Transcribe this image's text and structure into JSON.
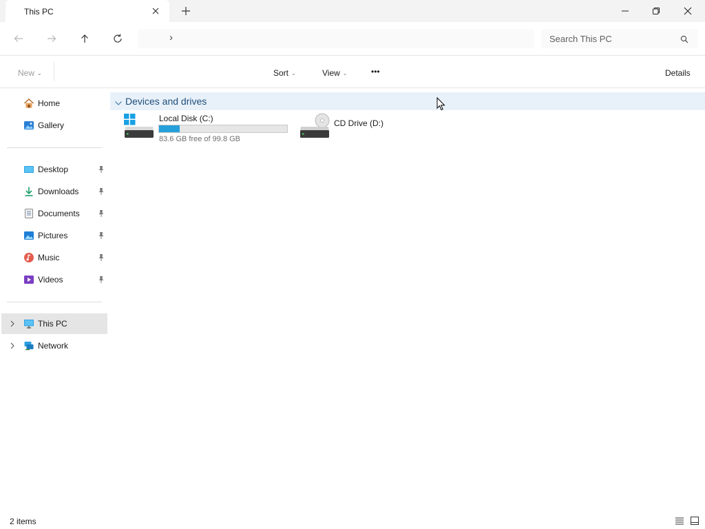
{
  "window": {
    "tab_title": "This PC",
    "controls": [
      "minimize-icon",
      "restore-icon",
      "close-icon"
    ]
  },
  "navigation": {
    "address_separator": "›",
    "search_placeholder": "Search This PC"
  },
  "commandbar": {
    "new_label": "New",
    "sort_label": "Sort",
    "view_label": "View",
    "more_label": "•••",
    "details_label": "Details"
  },
  "sidebar": {
    "quick": [
      {
        "label": "Home",
        "icon": "home-icon"
      },
      {
        "label": "Gallery",
        "icon": "gallery-icon"
      }
    ],
    "pinned": [
      {
        "label": "Desktop",
        "icon": "desktop-icon"
      },
      {
        "label": "Downloads",
        "icon": "download-icon"
      },
      {
        "label": "Documents",
        "icon": "documents-icon"
      },
      {
        "label": "Pictures",
        "icon": "pictures-icon"
      },
      {
        "label": "Music",
        "icon": "music-icon"
      },
      {
        "label": "Videos",
        "icon": "videos-icon"
      }
    ],
    "locations": [
      {
        "label": "This PC",
        "icon": "pc-icon",
        "selected": true
      },
      {
        "label": "Network",
        "icon": "network-icon",
        "selected": false
      }
    ]
  },
  "main": {
    "group_title": "Devices and drives",
    "drives": [
      {
        "name": "Local Disk (C:)",
        "free_text": "83.6 GB free of 99.8 GB",
        "used_fraction": 0.162
      },
      {
        "name": "CD Drive (D:)"
      }
    ]
  },
  "status": {
    "items_count": "2 items"
  },
  "colors": {
    "accent": "#26a0da",
    "selection": "#e5e5e5",
    "group_header": "#e8f1fa"
  }
}
